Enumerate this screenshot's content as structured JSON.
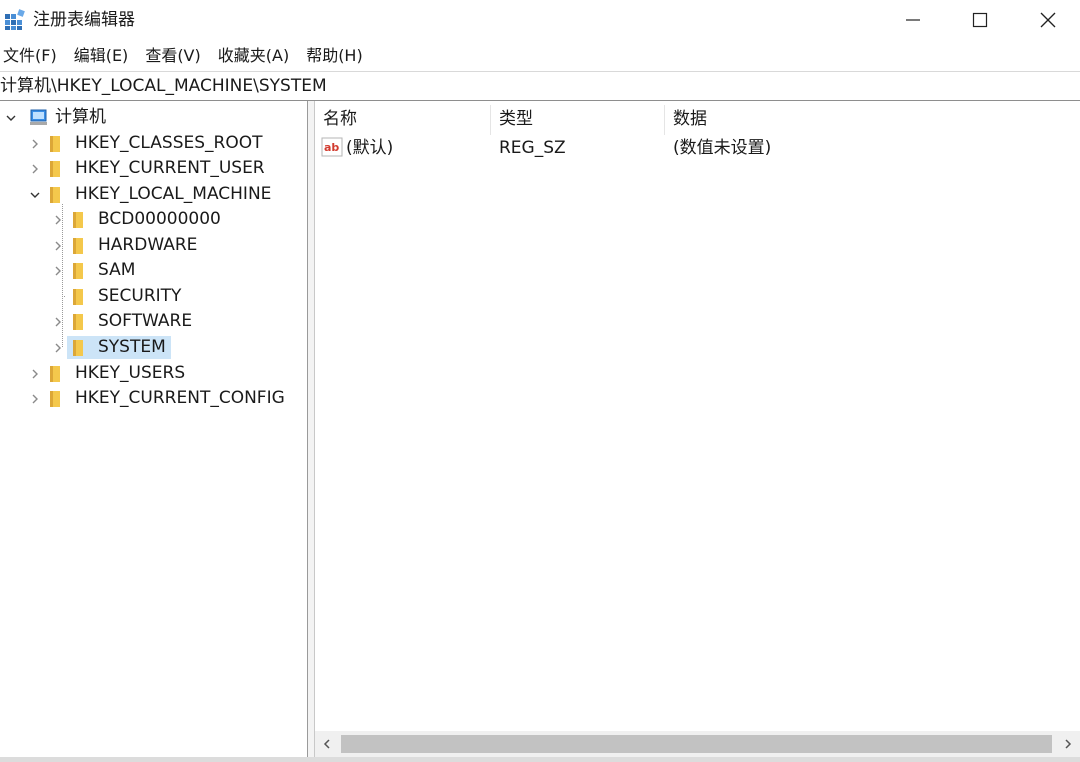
{
  "window": {
    "title": "注册表编辑器",
    "app_icon": "registry-editor-icon",
    "controls": {
      "minimize": "minimize-icon",
      "maximize": "maximize-icon",
      "close": "close-icon"
    }
  },
  "menu": [
    "文件(F)",
    "编辑(E)",
    "查看(V)",
    "收藏夹(A)",
    "帮助(H)"
  ],
  "address": "计算机\\HKEY_LOCAL_MACHINE\\SYSTEM",
  "tree": {
    "root": "计算机",
    "hives": [
      {
        "label": "HKEY_CLASSES_ROOT",
        "expanded": false
      },
      {
        "label": "HKEY_CURRENT_USER",
        "expanded": false
      },
      {
        "label": "HKEY_LOCAL_MACHINE",
        "expanded": true,
        "children": [
          {
            "label": "BCD00000000",
            "has_children": true
          },
          {
            "label": "HARDWARE",
            "has_children": true
          },
          {
            "label": "SAM",
            "has_children": true
          },
          {
            "label": "SECURITY",
            "has_children": false
          },
          {
            "label": "SOFTWARE",
            "has_children": true
          },
          {
            "label": "SYSTEM",
            "has_children": true,
            "selected": true
          }
        ]
      },
      {
        "label": "HKEY_USERS",
        "expanded": false
      },
      {
        "label": "HKEY_CURRENT_CONFIG",
        "expanded": false
      }
    ]
  },
  "list": {
    "columns": [
      "名称",
      "类型",
      "数据"
    ],
    "rows": [
      {
        "name": "(默认)",
        "type": "REG_SZ",
        "data": "(数值未设置)",
        "icon": "string-value-icon"
      }
    ]
  },
  "colors": {
    "selection": "#cce4f7",
    "folder": "#f4c84c",
    "folder_dark": "#dca737"
  }
}
